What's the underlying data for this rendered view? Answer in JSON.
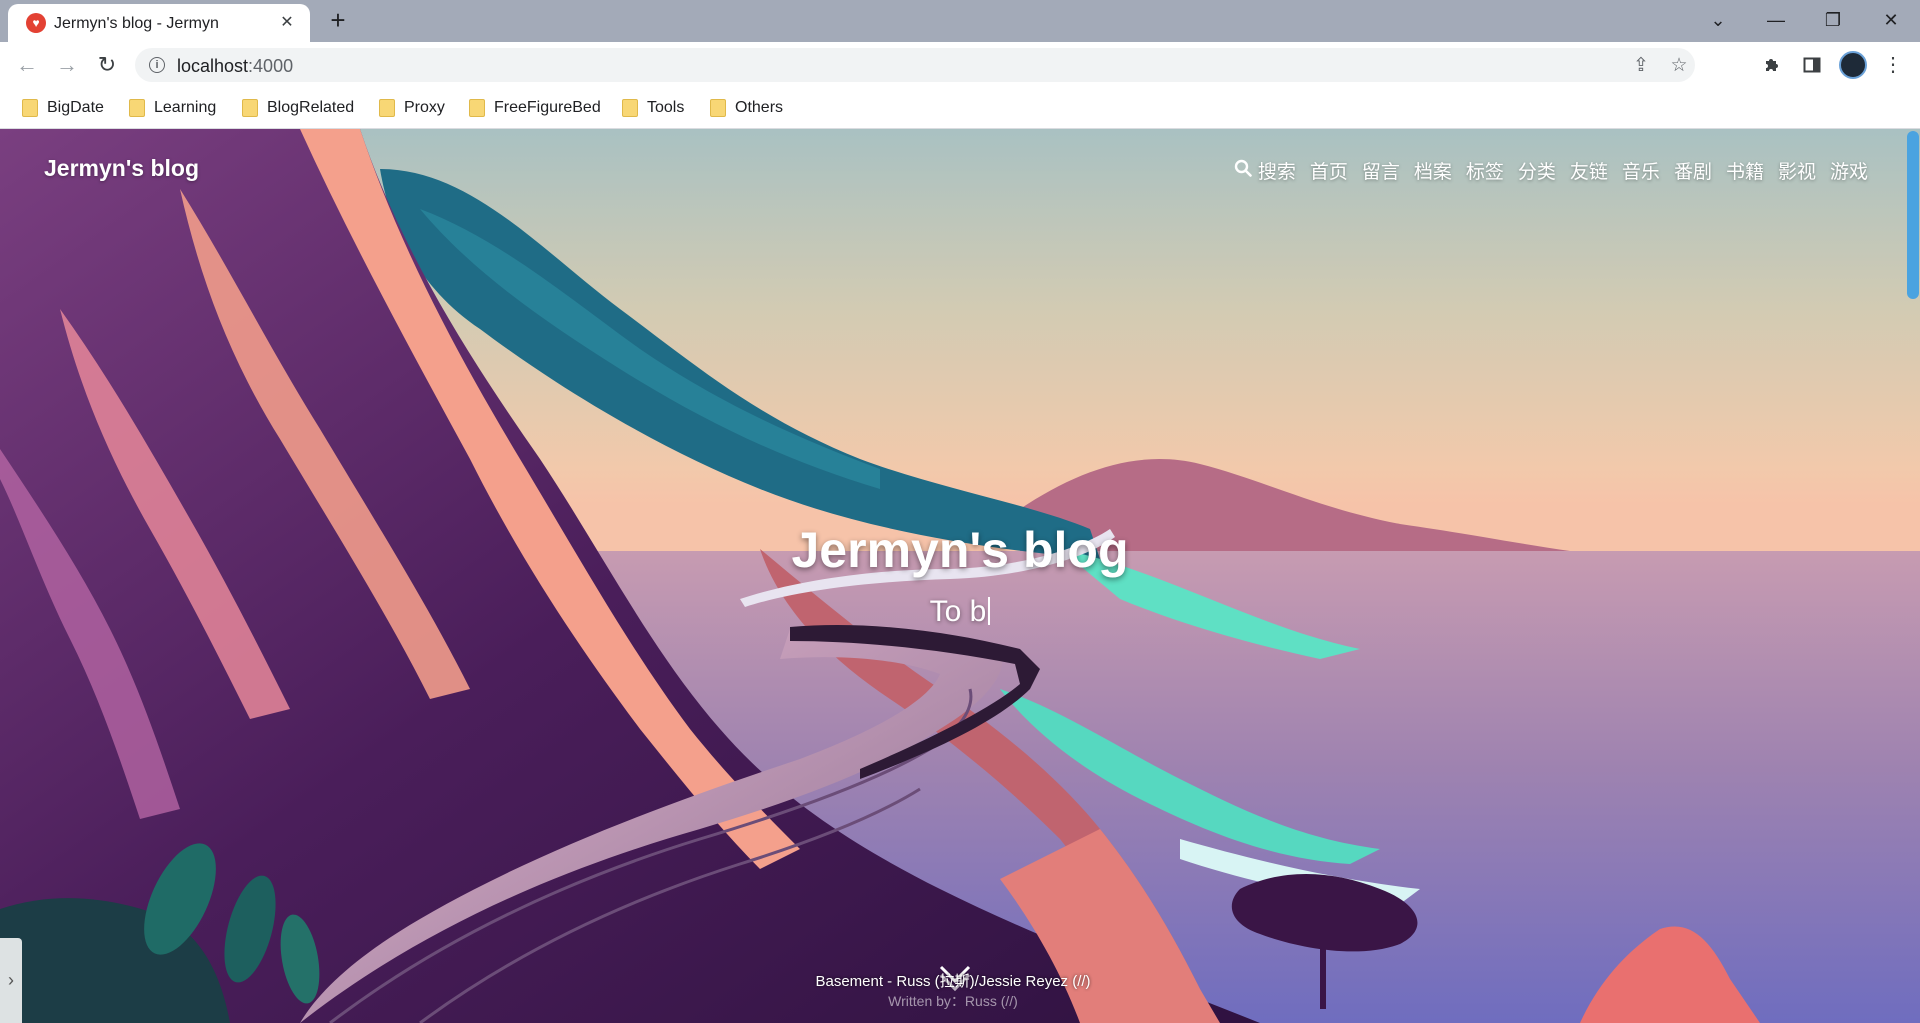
{
  "browser": {
    "tab": {
      "title": "Jermyn's blog - Jermyn",
      "close": "✕"
    },
    "new_tab": "+",
    "window": {
      "dropdown": "⌄",
      "minimize": "—",
      "restore": "❐",
      "close": "✕"
    },
    "nav": {
      "back": "←",
      "forward": "→",
      "reload": "↻"
    },
    "omnibox": {
      "host": "localhost",
      "port": ":4000"
    },
    "bookmarks": [
      "BigDate",
      "Learning",
      "BlogRelated",
      "Proxy",
      "FreeFigureBed",
      "Tools",
      "Others"
    ]
  },
  "site": {
    "brand": "Jermyn's blog",
    "nav": [
      "搜索",
      "首页",
      "留言",
      "档案",
      "标签",
      "分类",
      "友链",
      "音乐",
      "番剧",
      "书籍",
      "影视",
      "游戏"
    ],
    "hero_title": "Jermyn's blog",
    "hero_subtitle": "To b",
    "player": {
      "toggle": "›",
      "lyric": "Basement - Russ (拉斯)/Jessie Reyez (//)",
      "credit": "Written by：Russ (//)"
    }
  },
  "colors": {
    "accent": "#4aa3e0",
    "tab_favicon": "#e34133",
    "folder": "#f8d775"
  }
}
